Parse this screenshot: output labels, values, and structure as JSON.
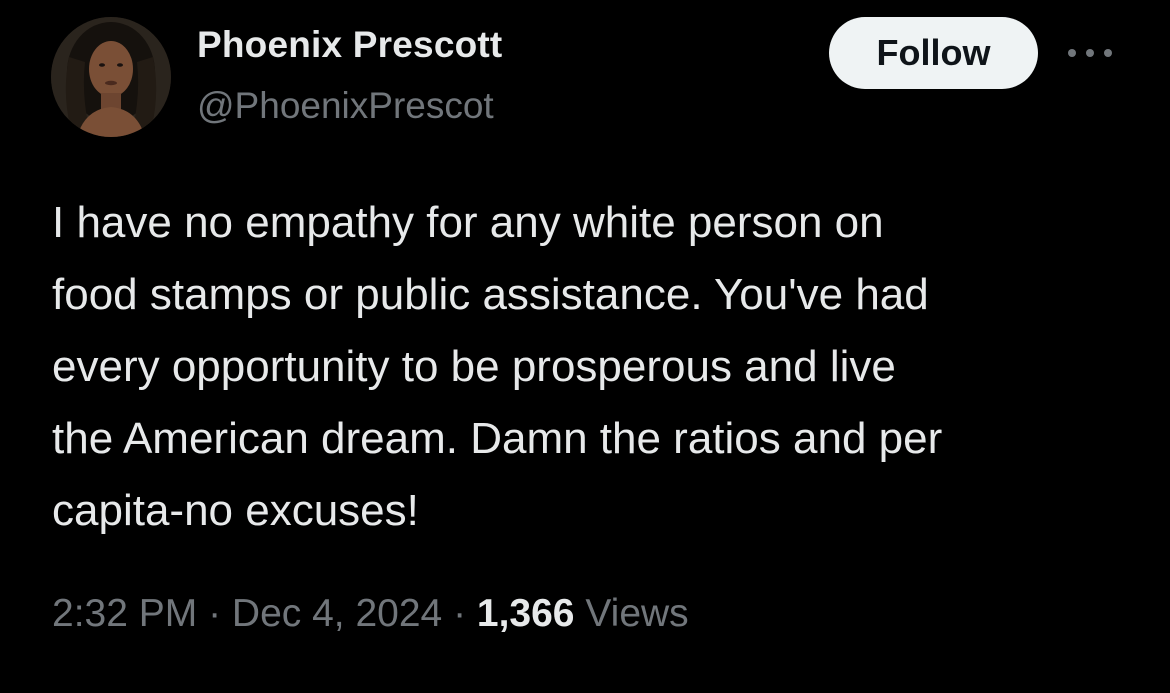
{
  "author": {
    "display_name": "Phoenix Prescott",
    "handle": "@PhoenixPrescot",
    "avatar_icon": "profile-photo"
  },
  "actions": {
    "follow_label": "Follow",
    "more_icon": "ellipsis-icon"
  },
  "tweet": {
    "text": "I have no empathy for any white person on\nfood stamps or public assistance. You've had\nevery opportunity to be prosperous and live\nthe American dream. Damn the ratios and per\ncapita-no excuses!"
  },
  "meta": {
    "time": "2:32 PM",
    "separator": " · ",
    "date": "Dec 4, 2024",
    "views_count": "1,366",
    "views_label": " Views"
  },
  "colors": {
    "background": "#000000",
    "primary_text": "#e7e9ea",
    "secondary_text": "#71767b",
    "follow_bg": "#eff3f4",
    "follow_text": "#0f1419"
  }
}
